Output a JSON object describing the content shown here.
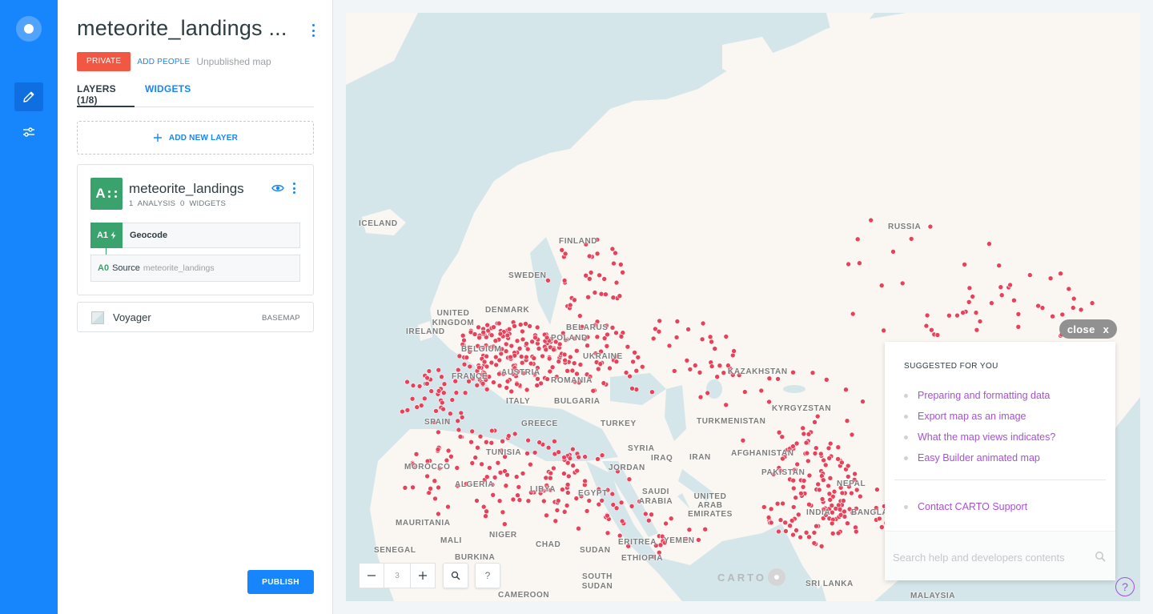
{
  "rail": {
    "logo": "carto-logo",
    "items": [
      {
        "name": "edit-icon",
        "active": true
      },
      {
        "name": "settings-sliders-icon",
        "active": false
      }
    ]
  },
  "header": {
    "title": "meteorite_landings ...",
    "privacy": "PRIVATE",
    "add_people": "ADD PEOPLE",
    "status": "Unpublished map"
  },
  "tabs": [
    {
      "label": "LAYERS (1/8)",
      "active": true
    },
    {
      "label": "WIDGETS",
      "active": false
    }
  ],
  "add_layer": "ADD NEW LAYER",
  "layer": {
    "letter": "A",
    "name": "meteorite_landings",
    "analysis_count": "1 ANALYSIS",
    "widget_count": "0 WIDGETS",
    "analysis": {
      "id": "A1",
      "label": "Geocode"
    },
    "source": {
      "id": "A0",
      "label": "Source",
      "dataset": "meteorite_landings"
    },
    "color": "#3aa36d"
  },
  "basemap": {
    "name": "Voyager",
    "tag": "BASEMAP"
  },
  "publish": "PUBLISH",
  "map": {
    "zoom_level": "3",
    "attribution": "CARTO",
    "point_color": "#e8425a",
    "countries": [
      "ICELAND",
      "FINLAND",
      "SWEDEN",
      "RUSSIA",
      "UNITED KINGDOM",
      "IRELAND",
      "DENMARK",
      "BELARUS",
      "POLAND",
      "BELGIUM",
      "UKRAINE",
      "FRANCE",
      "AUSTRIA",
      "ROMANIA",
      "KAZAKHSTAN",
      "KYRGYZSTAN",
      "SPAIN",
      "ITALY",
      "BULGARIA",
      "GREECE",
      "TURKEY",
      "TURKMENISTAN",
      "TUNISIA",
      "SYRIA",
      "IRAQ",
      "IRAN",
      "AFGHANISTAN",
      "MOROCCO",
      "ALGERIA",
      "LIBYA",
      "EGYPT",
      "JORDAN",
      "PAKISTAN",
      "NEPAL",
      "SAUDI ARABIA",
      "UNITED ARAB EMIRATES",
      "INDIA",
      "BANGLAD",
      "MAURITANIA",
      "MALI",
      "NIGER",
      "CHAD",
      "SUDAN",
      "ERITREA",
      "YEMEN",
      "SENEGAL",
      "BURKINA",
      "ETHIOPIA",
      "SOUTH SUDAN",
      "CAMEROON",
      "SRI LANKA",
      "MALAYSIA"
    ]
  },
  "help": {
    "close_label": "close",
    "close_x": "x",
    "header": "SUGGESTED FOR YOU",
    "links": [
      "Preparing and formatting data",
      "Export map as an image",
      "What the map views indicates?",
      "Easy Builder animated map"
    ],
    "support": "Contact CARTO Support",
    "search_placeholder": "Search help and developers contents",
    "fab": "?"
  }
}
